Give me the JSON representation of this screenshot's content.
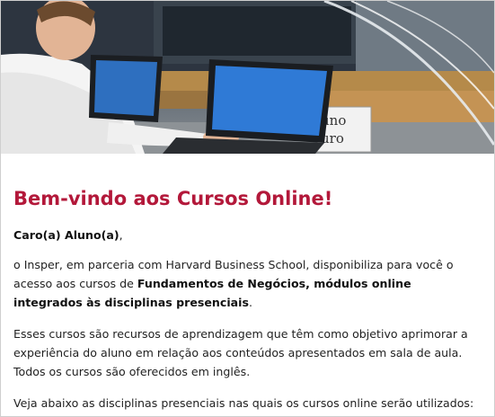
{
  "banner": {
    "alt": "Sala de aula com alunos usando notebooks",
    "sign_line1": "uno",
    "sign_line2": "uro"
  },
  "welcome_title": "Bem-vindo aos Cursos Online!",
  "greeting": {
    "bold": "Caro(a) Aluno(a)",
    "suffix": ","
  },
  "paragraph1": {
    "part1": "o Insper, em parceria com Harvard Business School, disponibiliza para você o acesso aos cursos de ",
    "bold": "Fundamentos de Negócios, módulos online integrados às disciplinas presenciais",
    "part2": "."
  },
  "paragraph2": "Esses cursos são recursos de aprendizagem que têm como objetivo aprimorar a experiência do aluno em relação aos conteúdos apresentados em sala de aula. Todos os cursos são oferecidos em inglês.",
  "paragraph3": "Veja abaixo as disciplinas presenciais nas quais os cursos online serão utilizados:"
}
